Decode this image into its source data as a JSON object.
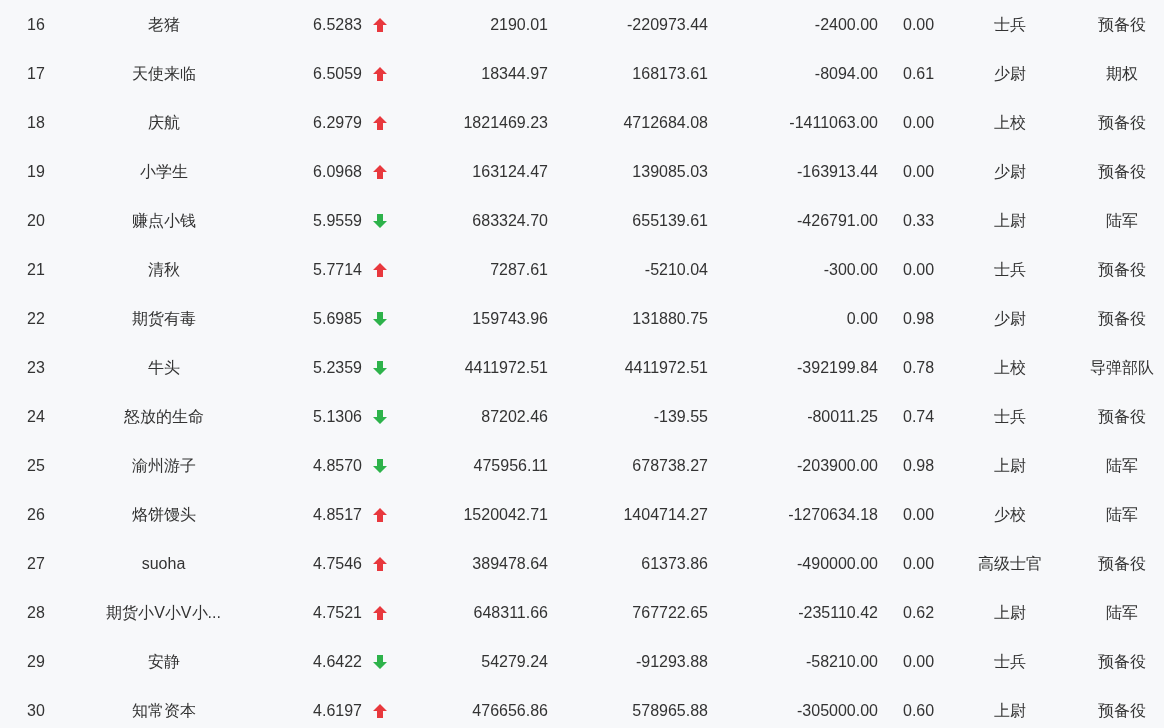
{
  "rows": [
    {
      "rank": "16",
      "name": "老猪",
      "score": "6.5283",
      "rising": true,
      "column_4": "2190.01",
      "column_5": "-220973.44",
      "column_6": "-2400.00",
      "column_7": "0.00",
      "rank_title": "士兵",
      "unit": "预备役"
    },
    {
      "rank": "17",
      "name": "天使来临",
      "score": "6.5059",
      "rising": true,
      "column_4": "18344.97",
      "column_5": "168173.61",
      "column_6": "-8094.00",
      "column_7": "0.61",
      "rank_title": "少尉",
      "unit": "期权"
    },
    {
      "rank": "18",
      "name": "庆航",
      "score": "6.2979",
      "rising": true,
      "column_4": "1821469.23",
      "column_5": "4712684.08",
      "column_6": "-1411063.00",
      "column_7": "0.00",
      "rank_title": "上校",
      "unit": "预备役"
    },
    {
      "rank": "19",
      "name": "小学生",
      "score": "6.0968",
      "rising": true,
      "column_4": "163124.47",
      "column_5": "139085.03",
      "column_6": "-163913.44",
      "column_7": "0.00",
      "rank_title": "少尉",
      "unit": "预备役"
    },
    {
      "rank": "20",
      "name": "赚点小钱",
      "score": "5.9559",
      "rising": false,
      "column_4": "683324.70",
      "column_5": "655139.61",
      "column_6": "-426791.00",
      "column_7": "0.33",
      "rank_title": "上尉",
      "unit": "陆军"
    },
    {
      "rank": "21",
      "name": "清秋",
      "score": "5.7714",
      "rising": true,
      "column_4": "7287.61",
      "column_5": "-5210.04",
      "column_6": "-300.00",
      "column_7": "0.00",
      "rank_title": "士兵",
      "unit": "预备役"
    },
    {
      "rank": "22",
      "name": "期货有毒",
      "score": "5.6985",
      "rising": false,
      "column_4": "159743.96",
      "column_5": "131880.75",
      "column_6": "0.00",
      "column_7": "0.98",
      "rank_title": "少尉",
      "unit": "预备役"
    },
    {
      "rank": "23",
      "name": "牛头",
      "score": "5.2359",
      "rising": false,
      "column_4": "4411972.51",
      "column_5": "4411972.51",
      "column_6": "-392199.84",
      "column_7": "0.78",
      "rank_title": "上校",
      "unit": "导弹部队"
    },
    {
      "rank": "24",
      "name": "怒放的生命",
      "score": "5.1306",
      "rising": false,
      "column_4": "87202.46",
      "column_5": "-139.55",
      "column_6": "-80011.25",
      "column_7": "0.74",
      "rank_title": "士兵",
      "unit": "预备役"
    },
    {
      "rank": "25",
      "name": "渝州游子",
      "score": "4.8570",
      "rising": false,
      "column_4": "475956.11",
      "column_5": "678738.27",
      "column_6": "-203900.00",
      "column_7": "0.98",
      "rank_title": "上尉",
      "unit": "陆军"
    },
    {
      "rank": "26",
      "name": "烙饼馒头",
      "score": "4.8517",
      "rising": true,
      "column_4": "1520042.71",
      "column_5": "1404714.27",
      "column_6": "-1270634.18",
      "column_7": "0.00",
      "rank_title": "少校",
      "unit": "陆军"
    },
    {
      "rank": "27",
      "name": "suoha",
      "score": "4.7546",
      "rising": true,
      "column_4": "389478.64",
      "column_5": "61373.86",
      "column_6": "-490000.00",
      "column_7": "0.00",
      "rank_title": "高级士官",
      "unit": "预备役"
    },
    {
      "rank": "28",
      "name": "期货小V小V小...",
      "score": "4.7521",
      "rising": true,
      "column_4": "648311.66",
      "column_5": "767722.65",
      "column_6": "-235110.42",
      "column_7": "0.62",
      "rank_title": "上尉",
      "unit": "陆军"
    },
    {
      "rank": "29",
      "name": "安静",
      "score": "4.6422",
      "rising": false,
      "column_4": "54279.24",
      "column_5": "-91293.88",
      "column_6": "-58210.00",
      "column_7": "0.00",
      "rank_title": "士兵",
      "unit": "预备役"
    },
    {
      "rank": "30",
      "name": "知常资本",
      "score": "4.6197",
      "rising": true,
      "column_4": "476656.86",
      "column_5": "578965.88",
      "column_6": "-305000.00",
      "column_7": "0.60",
      "rank_title": "上尉",
      "unit": "预备役"
    }
  ]
}
